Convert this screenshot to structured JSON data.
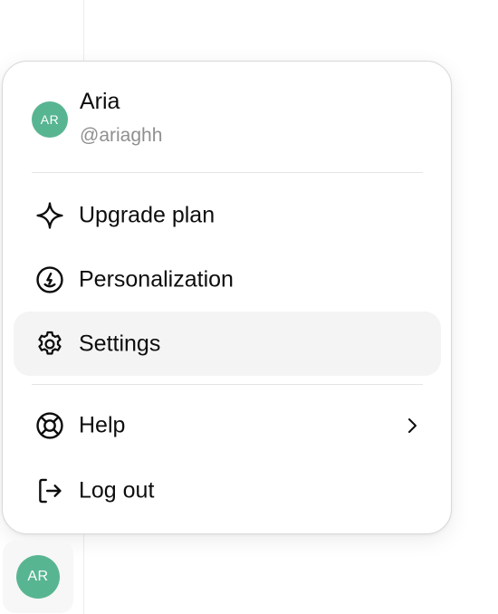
{
  "user": {
    "initials": "AR",
    "name": "Aria",
    "handle": "@ariaghh"
  },
  "menu": {
    "items": [
      {
        "label": "Upgrade plan",
        "icon": "sparkle-icon"
      },
      {
        "label": "Personalization",
        "icon": "personalization-icon"
      },
      {
        "label": "Settings",
        "icon": "gear-icon",
        "active": true
      },
      {
        "label": "Help",
        "icon": "lifebuoy-icon",
        "has_submenu": true
      },
      {
        "label": "Log out",
        "icon": "logout-icon"
      }
    ]
  },
  "colors": {
    "avatar_bg": "#58b592",
    "active_item_bg": "#f4f4f4",
    "handle_text": "#8f8f8f"
  }
}
